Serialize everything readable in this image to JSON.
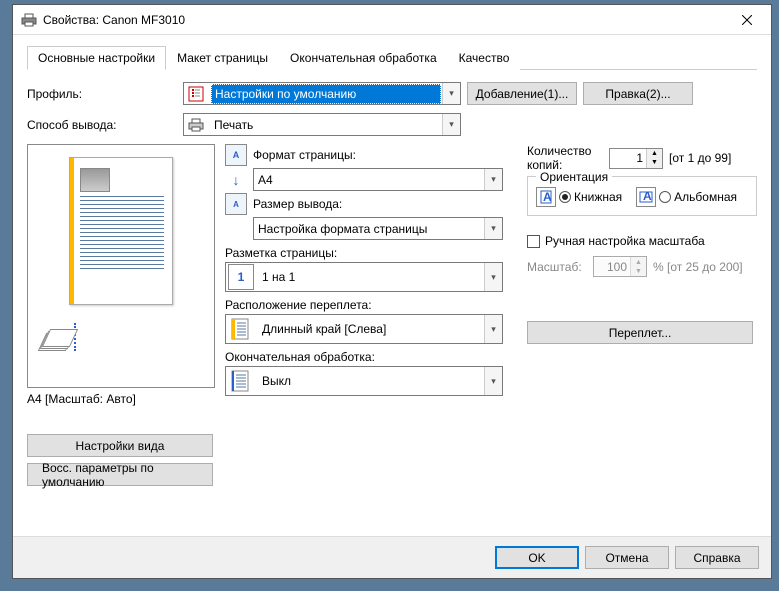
{
  "window": {
    "title": "Свойства: Canon MF3010"
  },
  "tabs": [
    "Основные настройки",
    "Макет страницы",
    "Окончательная обработка",
    "Качество"
  ],
  "active_tab": 0,
  "profile": {
    "label": "Профиль:",
    "value": "Настройки по умолчанию"
  },
  "buttons": {
    "add": "Добавление(1)...",
    "edit": "Правка(2)...",
    "view_settings": "Настройки вида",
    "restore_defaults": "Восс. параметры по умолчанию",
    "binding": "Переплет...",
    "ok": "OK",
    "cancel": "Отмена",
    "help": "Справка"
  },
  "output": {
    "label": "Способ вывода:",
    "value": "Печать"
  },
  "preview": {
    "caption": "A4 [Масштаб: Авто]"
  },
  "page_size": {
    "label": "Формат страницы:",
    "value": "A4"
  },
  "output_size": {
    "label": "Размер вывода:",
    "value": "Настройка формата страницы"
  },
  "page_layout": {
    "label": "Разметка страницы:",
    "value": "1 на 1",
    "icon_text": "1"
  },
  "binding_loc": {
    "label": "Расположение переплета:",
    "value": "Длинный край [Слева]"
  },
  "finishing": {
    "label": "Окончательная обработка:",
    "value": "Выкл"
  },
  "copies": {
    "label": "Количество копий:",
    "value": "1",
    "range": "[от 1 до 99]"
  },
  "orientation": {
    "legend": "Ориентация",
    "portrait": "Книжная",
    "landscape": "Альбомная",
    "selected": "portrait"
  },
  "manual_scale": {
    "label": "Ручная настройка масштаба",
    "checked": false
  },
  "scale": {
    "label": "Масштаб:",
    "value": "100",
    "suffix": "% [от 25 до 200]"
  }
}
